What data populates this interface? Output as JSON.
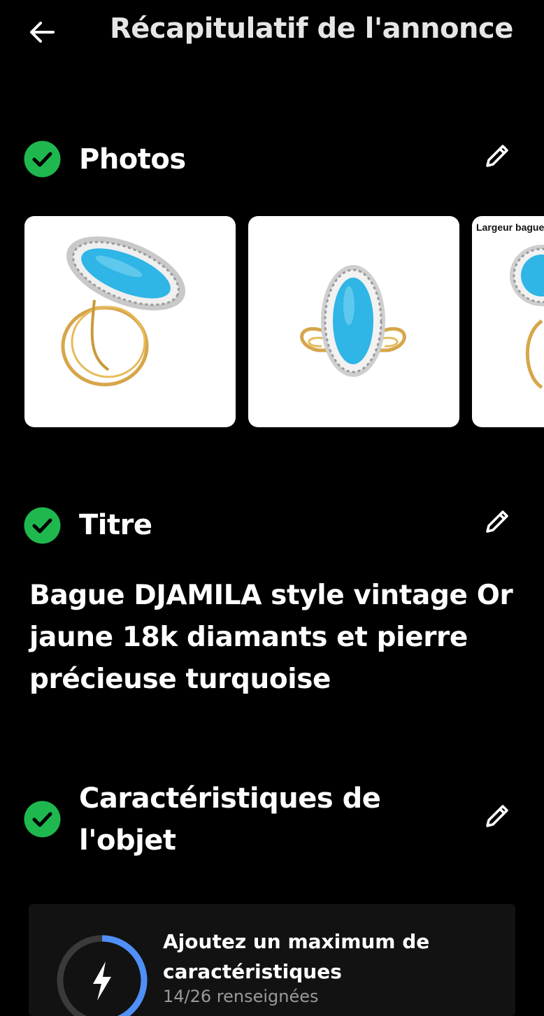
{
  "header": {
    "back_icon": "arrow-left-icon",
    "title": "Récapitulatif de l'annonce"
  },
  "sections": {
    "photos": {
      "label": "Photos",
      "status_icon": "check-circle-icon",
      "edit_icon": "pencil-icon",
      "images": [
        {
          "alt": "ring-turquoise-angled"
        },
        {
          "alt": "ring-turquoise-front"
        },
        {
          "alt": "ring-turquoise-dimensions",
          "caption": "Largeur bague"
        }
      ]
    },
    "title": {
      "label": "Titre",
      "status_icon": "check-circle-icon",
      "edit_icon": "pencil-icon",
      "value": "Bague DJAMILA style vintage Or jaune 18k diamants et pierre précieuse turquoise"
    },
    "characteristics": {
      "label": "Caractéristiques de l'objet",
      "status_icon": "check-circle-icon",
      "edit_icon": "pencil-icon",
      "tip": {
        "icon": "lightning-icon",
        "title": "Ajoutez un maximum de caractéristiques",
        "subtitle": "14/26 renseignées"
      }
    }
  },
  "colors": {
    "background": "#000000",
    "check_green": "#1fb84f",
    "ring_progress": "#4f8ff7",
    "ring_track": "#3a3a3a",
    "turquoise": "#2fb5e6",
    "gold": "#d6a64a"
  }
}
